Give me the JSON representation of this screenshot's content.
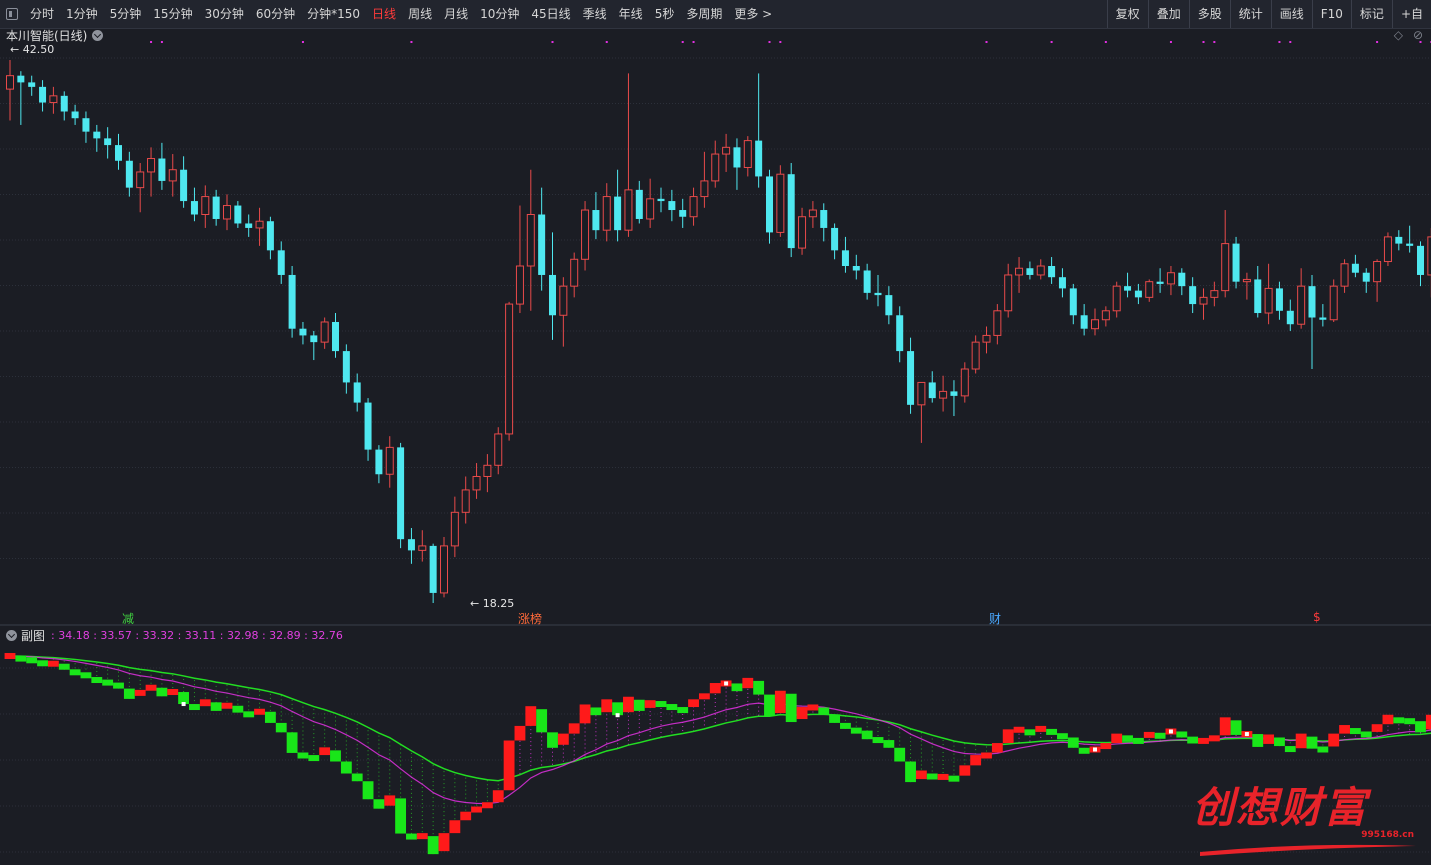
{
  "toolbar": {
    "periods": [
      {
        "label": "分时",
        "active": false
      },
      {
        "label": "1分钟",
        "active": false
      },
      {
        "label": "5分钟",
        "active": false
      },
      {
        "label": "15分钟",
        "active": false
      },
      {
        "label": "30分钟",
        "active": false
      },
      {
        "label": "60分钟",
        "active": false
      },
      {
        "label": "分钟*150",
        "active": false
      },
      {
        "label": "日线",
        "active": true
      },
      {
        "label": "周线",
        "active": false
      },
      {
        "label": "月线",
        "active": false
      },
      {
        "label": "10分钟",
        "active": false
      },
      {
        "label": "45日线",
        "active": false
      },
      {
        "label": "季线",
        "active": false
      },
      {
        "label": "年线",
        "active": false
      },
      {
        "label": "5秒",
        "active": false
      },
      {
        "label": "多周期",
        "active": false
      },
      {
        "label": "更多 >",
        "active": false
      }
    ],
    "right_items": [
      "复权",
      "叠加",
      "多股",
      "统计",
      "画线",
      "F10",
      "标记",
      "+自"
    ]
  },
  "main_chart": {
    "title": "本川智能(日线)",
    "high_label": "42.50",
    "low_label": "18.25",
    "right_icons": [
      "◇",
      "⊘"
    ],
    "events": [
      {
        "text": "减",
        "color": "#40d040"
      },
      {
        "text": "涨榜",
        "color": "#ff6a3a"
      },
      {
        "text": "财",
        "color": "#4aa8ff"
      },
      {
        "text": "$",
        "color": "#ff3b3b"
      }
    ]
  },
  "sub_chart": {
    "title": "副图",
    "values": ": 34.18 : 33.57 : 33.32 : 33.11 : 32.98 : 32.89 : 32.76"
  },
  "watermark": {
    "text": "创想财富",
    "url": "995168.cn"
  },
  "colors": {
    "up": "#e84a4a",
    "down": "#4fe8f0",
    "grid": "#2c303a",
    "sub_green": "#19e619",
    "sub_red": "#ff1a1a",
    "sub_magenta": "#e030e0"
  },
  "chart_data": {
    "type": "candlestick",
    "price_range": [
      18.25,
      42.5
    ],
    "candles": [
      [
        41.2,
        42.5,
        39.8,
        41.8
      ],
      [
        41.8,
        42.0,
        39.6,
        41.5
      ],
      [
        41.5,
        41.8,
        40.9,
        41.3
      ],
      [
        41.3,
        41.6,
        40.2,
        40.6
      ],
      [
        40.6,
        41.3,
        40.1,
        40.9
      ],
      [
        40.9,
        41.1,
        39.8,
        40.2
      ],
      [
        40.2,
        40.5,
        39.6,
        39.9
      ],
      [
        39.9,
        40.2,
        38.8,
        39.3
      ],
      [
        39.3,
        39.6,
        38.4,
        39.0
      ],
      [
        39.0,
        39.5,
        38.1,
        38.7
      ],
      [
        38.7,
        39.2,
        37.6,
        38.0
      ],
      [
        38.0,
        38.4,
        36.4,
        36.8
      ],
      [
        36.8,
        37.9,
        35.7,
        37.5
      ],
      [
        37.5,
        38.6,
        36.4,
        38.1
      ],
      [
        38.1,
        38.8,
        36.7,
        37.1
      ],
      [
        37.1,
        38.3,
        36.4,
        37.6
      ],
      [
        37.6,
        38.2,
        35.9,
        36.2
      ],
      [
        36.2,
        36.8,
        35.3,
        35.6
      ],
      [
        35.6,
        36.9,
        35.0,
        36.4
      ],
      [
        36.4,
        36.7,
        35.1,
        35.4
      ],
      [
        35.4,
        36.5,
        34.9,
        36.0
      ],
      [
        36.0,
        36.2,
        35.0,
        35.2
      ],
      [
        35.2,
        35.6,
        34.6,
        35.0
      ],
      [
        35.0,
        35.9,
        34.2,
        35.3
      ],
      [
        35.3,
        35.5,
        33.6,
        34.0
      ],
      [
        34.0,
        34.4,
        32.5,
        32.9
      ],
      [
        32.9,
        33.3,
        30.1,
        30.5
      ],
      [
        30.5,
        30.8,
        29.8,
        30.2
      ],
      [
        30.2,
        30.4,
        29.1,
        29.9
      ],
      [
        29.9,
        31.0,
        29.6,
        30.8
      ],
      [
        30.8,
        31.2,
        29.2,
        29.5
      ],
      [
        29.5,
        29.8,
        27.6,
        28.1
      ],
      [
        28.1,
        28.5,
        26.8,
        27.2
      ],
      [
        27.2,
        27.4,
        24.6,
        25.1
      ],
      [
        25.1,
        25.3,
        23.6,
        24.0
      ],
      [
        24.0,
        25.7,
        23.4,
        25.2
      ],
      [
        25.2,
        25.4,
        20.7,
        21.1
      ],
      [
        21.1,
        21.6,
        20.0,
        20.6
      ],
      [
        20.6,
        21.5,
        20.1,
        20.8
      ],
      [
        20.8,
        20.9,
        18.25,
        18.7
      ],
      [
        18.7,
        21.2,
        18.5,
        20.8
      ],
      [
        20.8,
        23.0,
        20.3,
        22.3
      ],
      [
        22.3,
        23.9,
        21.8,
        23.3
      ],
      [
        23.3,
        24.5,
        22.9,
        23.9
      ],
      [
        23.9,
        24.9,
        23.2,
        24.4
      ],
      [
        24.4,
        26.1,
        24.0,
        25.8
      ],
      [
        25.8,
        31.7,
        25.5,
        31.6
      ],
      [
        31.6,
        36.0,
        31.2,
        33.3
      ],
      [
        33.3,
        37.6,
        31.3,
        35.6
      ],
      [
        35.6,
        36.8,
        32.2,
        32.9
      ],
      [
        32.9,
        34.8,
        30.0,
        31.1
      ],
      [
        31.1,
        32.8,
        29.7,
        32.4
      ],
      [
        32.4,
        33.9,
        31.9,
        33.6
      ],
      [
        33.6,
        36.2,
        33.1,
        35.8
      ],
      [
        35.8,
        36.6,
        34.5,
        34.9
      ],
      [
        34.9,
        37.0,
        34.4,
        36.4
      ],
      [
        36.4,
        37.6,
        34.4,
        34.9
      ],
      [
        34.9,
        41.9,
        34.6,
        36.7
      ],
      [
        36.7,
        37.1,
        35.2,
        35.4
      ],
      [
        35.4,
        37.2,
        35.0,
        36.3
      ],
      [
        36.3,
        36.8,
        35.7,
        36.2
      ],
      [
        36.2,
        36.7,
        35.3,
        35.8
      ],
      [
        35.8,
        36.3,
        35.0,
        35.5
      ],
      [
        35.5,
        36.8,
        35.1,
        36.4
      ],
      [
        36.4,
        38.4,
        35.9,
        37.1
      ],
      [
        37.1,
        38.9,
        36.8,
        38.3
      ],
      [
        38.3,
        39.2,
        37.5,
        38.6
      ],
      [
        38.6,
        39.0,
        36.7,
        37.7
      ],
      [
        37.7,
        39.1,
        37.3,
        38.9
      ],
      [
        38.9,
        41.9,
        36.8,
        37.3
      ],
      [
        37.3,
        37.6,
        34.3,
        34.8
      ],
      [
        34.8,
        37.8,
        34.6,
        37.4
      ],
      [
        37.4,
        37.9,
        33.7,
        34.1
      ],
      [
        34.1,
        35.9,
        33.8,
        35.5
      ],
      [
        35.5,
        36.2,
        35.0,
        35.8
      ],
      [
        35.8,
        36.1,
        34.4,
        35.0
      ],
      [
        35.0,
        35.2,
        33.6,
        34.0
      ],
      [
        34.0,
        34.6,
        33.0,
        33.3
      ],
      [
        33.3,
        33.8,
        32.7,
        33.1
      ],
      [
        33.1,
        33.4,
        31.8,
        32.1
      ],
      [
        32.1,
        32.9,
        31.5,
        32.0
      ],
      [
        32.0,
        32.4,
        30.7,
        31.1
      ],
      [
        31.1,
        31.5,
        29.0,
        29.5
      ],
      [
        29.5,
        30.1,
        26.7,
        27.1
      ],
      [
        27.1,
        27.6,
        25.4,
        28.1
      ],
      [
        28.1,
        28.6,
        27.2,
        27.4
      ],
      [
        27.4,
        28.4,
        26.8,
        27.7
      ],
      [
        27.7,
        28.2,
        26.6,
        27.5
      ],
      [
        27.5,
        29.0,
        27.2,
        28.7
      ],
      [
        28.7,
        30.2,
        28.5,
        29.9
      ],
      [
        29.9,
        30.6,
        29.4,
        30.2
      ],
      [
        30.2,
        31.6,
        29.8,
        31.3
      ],
      [
        31.3,
        33.4,
        31.0,
        32.9
      ],
      [
        32.9,
        33.7,
        32.1,
        33.2
      ],
      [
        33.2,
        33.5,
        32.7,
        32.9
      ],
      [
        32.9,
        33.6,
        32.7,
        33.3
      ],
      [
        33.3,
        33.7,
        32.5,
        32.8
      ],
      [
        32.8,
        33.2,
        31.9,
        32.3
      ],
      [
        32.3,
        32.5,
        30.7,
        31.1
      ],
      [
        31.1,
        31.6,
        30.2,
        30.5
      ],
      [
        30.5,
        31.4,
        30.2,
        30.9
      ],
      [
        30.9,
        31.5,
        30.6,
        31.3
      ],
      [
        31.3,
        32.6,
        31.0,
        32.4
      ],
      [
        32.4,
        33.0,
        31.9,
        32.2
      ],
      [
        32.2,
        32.5,
        31.6,
        31.9
      ],
      [
        31.9,
        32.7,
        31.7,
        32.6
      ],
      [
        32.6,
        33.2,
        32.1,
        32.5
      ],
      [
        32.5,
        33.3,
        32.0,
        33.0
      ],
      [
        33.0,
        33.2,
        32.0,
        32.4
      ],
      [
        32.4,
        32.8,
        31.2,
        31.6
      ],
      [
        31.6,
        32.3,
        30.9,
        31.9
      ],
      [
        31.9,
        32.6,
        31.5,
        32.2
      ],
      [
        32.2,
        35.8,
        31.9,
        34.3
      ],
      [
        34.3,
        34.6,
        32.3,
        32.6
      ],
      [
        32.6,
        33.0,
        31.8,
        32.7
      ],
      [
        32.7,
        33.3,
        31.0,
        31.2
      ],
      [
        31.2,
        33.4,
        30.7,
        32.3
      ],
      [
        32.3,
        32.6,
        30.9,
        31.3
      ],
      [
        31.3,
        31.8,
        30.4,
        30.7
      ],
      [
        30.7,
        33.2,
        30.5,
        32.4
      ],
      [
        32.4,
        32.9,
        28.7,
        31.0
      ],
      [
        31.0,
        31.6,
        30.6,
        30.9
      ],
      [
        30.9,
        32.7,
        30.8,
        32.4
      ],
      [
        32.4,
        33.6,
        32.1,
        33.4
      ],
      [
        33.4,
        33.8,
        32.8,
        33.0
      ],
      [
        33.0,
        33.2,
        32.1,
        32.6
      ],
      [
        32.6,
        33.6,
        31.7,
        33.5
      ],
      [
        33.5,
        34.8,
        33.3,
        34.6
      ],
      [
        34.6,
        34.9,
        34.0,
        34.3
      ],
      [
        34.3,
        35.1,
        33.9,
        34.2
      ],
      [
        34.2,
        34.4,
        32.4,
        32.9
      ],
      [
        32.9,
        35.0,
        31.9,
        34.6
      ],
      [
        34.6,
        37.5,
        32.4,
        34.6
      ],
      [
        34.6,
        39.0,
        34.2,
        37.6
      ]
    ],
    "markers_top_count": 21,
    "sub_indicator": {
      "name": "副图",
      "values": [
        34.18,
        33.57,
        33.32,
        33.11,
        32.98,
        32.89,
        32.76
      ]
    }
  }
}
